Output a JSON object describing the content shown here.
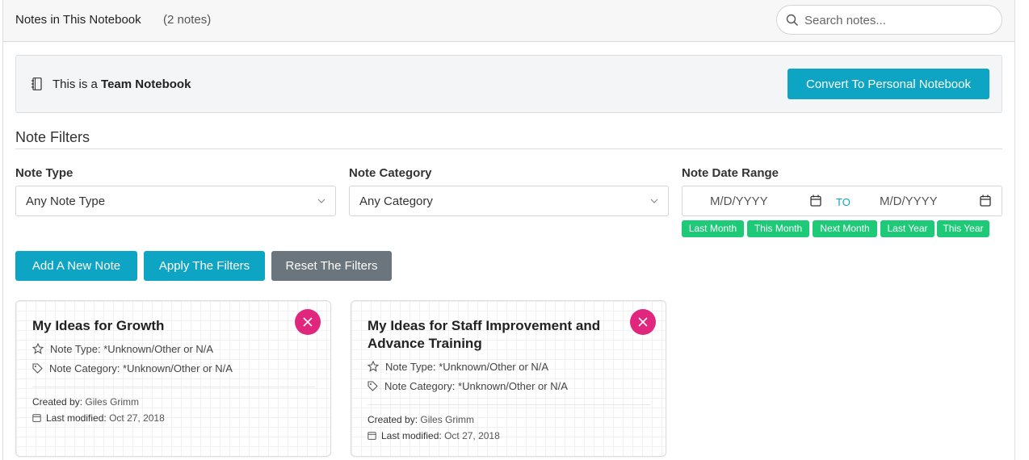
{
  "header": {
    "title": "Notes in This Notebook",
    "count": "(2 notes)",
    "search_placeholder": "Search notes..."
  },
  "team_box": {
    "prefix": "This is a",
    "notebook_type": "Team Notebook",
    "convert_label": "Convert To Personal Notebook"
  },
  "filters": {
    "title": "Note Filters",
    "note_type_label": "Note Type",
    "note_type_value": "Any Note Type",
    "category_label": "Note Category",
    "category_value": "Any Category",
    "date_label": "Note Date Range",
    "date_from_placeholder": "M/D/YYYY",
    "date_to_placeholder": "M/D/YYYY",
    "to_label": "TO",
    "quick_ranges": [
      "Last Month",
      "This Month",
      "Next Month",
      "Last Year",
      "This Year"
    ]
  },
  "actions": {
    "add": "Add A New Note",
    "apply": "Apply The Filters",
    "reset": "Reset The Filters"
  },
  "notes": [
    {
      "title": "My Ideas for Growth",
      "type_text": "Note Type: *Unknown/Other or N/A",
      "category_text": "Note Category: *Unknown/Other or N/A",
      "created_label": "Created by:",
      "created_by": "Giles Grimm",
      "modified_label": "Last modified:",
      "modified": "Oct 27, 2018"
    },
    {
      "title": "My Ideas for Staff Improvement and Advance Training",
      "type_text": "Note Type: *Unknown/Other or N/A",
      "category_text": "Note Category: *Unknown/Other or N/A",
      "created_label": "Created by:",
      "created_by": "Giles Grimm",
      "modified_label": "Last modified:",
      "modified": "Oct 27, 2018"
    }
  ],
  "colors": {
    "accent": "#0ea5c4",
    "chip": "#1ec977",
    "delete": "#e0267d",
    "reset": "#6b757d"
  }
}
